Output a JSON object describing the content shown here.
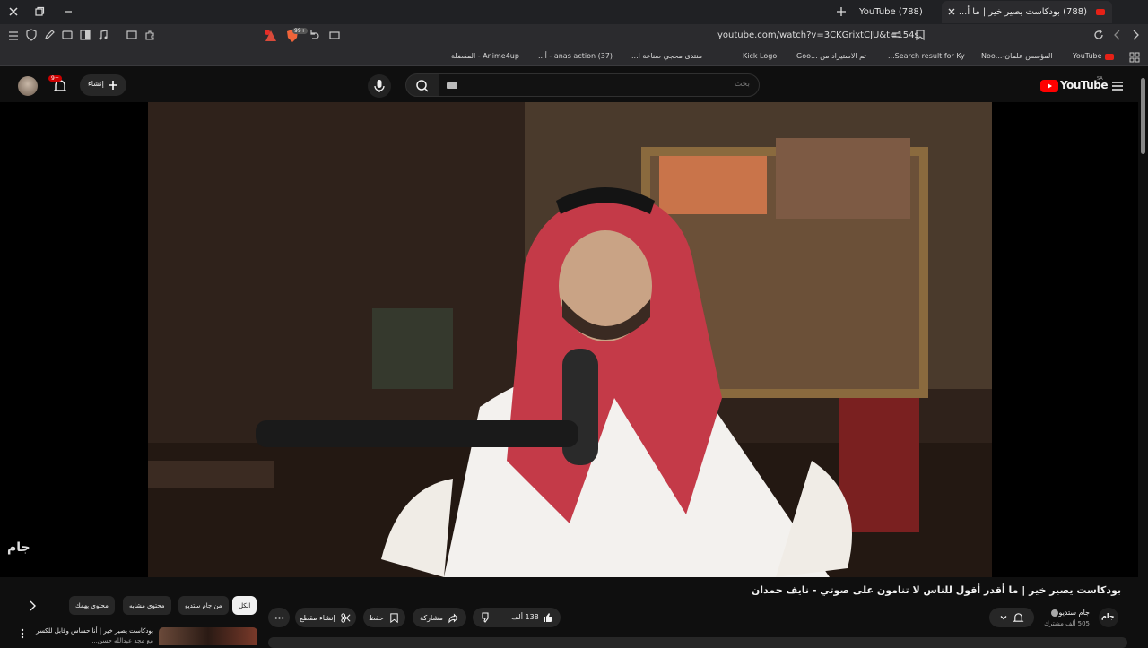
{
  "browser": {
    "tabs": [
      {
        "title": "(788) بودكاست يصير خير | ما أ..."
      },
      {
        "title": "(788) YouTube"
      }
    ],
    "url": "youtube.com/watch?v=3CKGrixtCJU&t=154s",
    "brave_badge": "99+",
    "bookmarks": [
      "YouTube",
      "المؤسس علمان-...Noo",
      "Search result for Ky...",
      "تم الاستيراد من ...Goo",
      "Kick Logo",
      "منتدى محجي صناعة ا...",
      "(37) anas action - أ...",
      "Anime4up - المفضلة"
    ]
  },
  "youtube": {
    "logo_text": "YouTube",
    "logo_region": "SA",
    "search_placeholder": "بحث",
    "create_label": "إنشاء",
    "notif_count": "9+",
    "video_title": "بودكاست يصير خير | ما أقدر أقول للناس لا تنامون على صوتي - نايف حمدان",
    "channel_name": "جام ستديو",
    "subscribers": "505 ألف مشترك",
    "like_count": "138 ألف",
    "share_label": "مشاركة",
    "save_label": "حفظ",
    "clip_label": "إنشاء مقطع",
    "watermark": "جام",
    "chips": [
      "الكل",
      "من جام ستديو",
      "محتوى مشابه",
      "محتوى يهمك"
    ],
    "next_video_title": "بودكاست يصير خير | أنا حساس وقابل للكسر",
    "next_video_sub": "مع مجد عبدالله حسن..."
  }
}
